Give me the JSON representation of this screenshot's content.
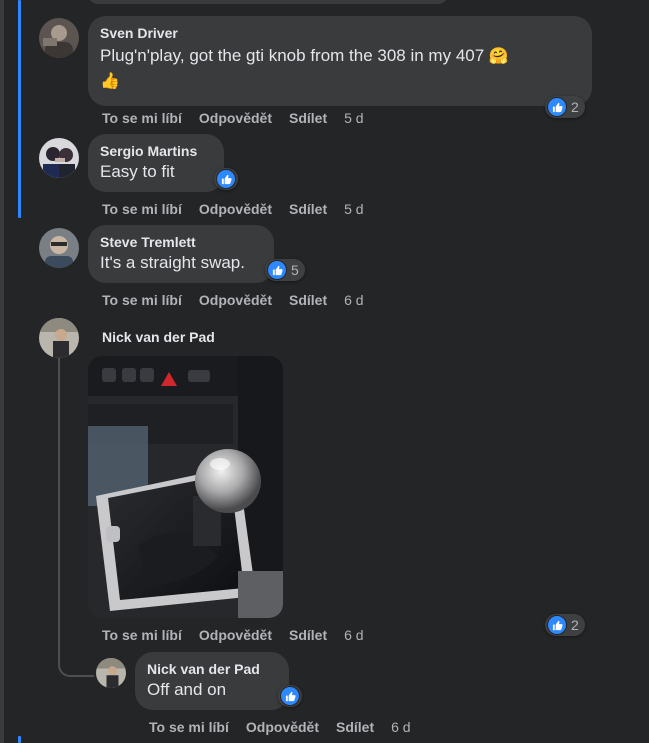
{
  "actions": {
    "like": "To se mi líbí",
    "reply": "Odpovědět",
    "share": "Sdílet"
  },
  "comments": [
    {
      "author": "Sven Driver",
      "text_line1": "Plug'n'play, got the gti knob from the 308 in my 407",
      "emoji1": "🤗",
      "emoji2": "👍",
      "time": "5 d",
      "reactions": {
        "icon": "like-icon",
        "count": "2"
      }
    },
    {
      "author": "Sergio Martins",
      "text": "Easy to fit",
      "time": "5 d",
      "reactions": {
        "icon": "like-icon",
        "count": ""
      }
    },
    {
      "author": "Steve Tremlett",
      "text": "It's a straight swap.",
      "time": "6 d",
      "reactions": {
        "icon": "like-icon",
        "count": "5"
      }
    },
    {
      "author": "Nick van der Pad",
      "text": "",
      "attachment": "gear-knob-photo",
      "time": "6 d",
      "reactions": {
        "icon": "like-icon",
        "count": "2"
      }
    },
    {
      "author": "Nick van der Pad",
      "text": "Off and on",
      "time": "6 d",
      "reactions": {
        "icon": "like-icon",
        "count": ""
      }
    }
  ],
  "colors": {
    "background": "#242526",
    "bubble": "#3a3b3c",
    "accent": "#2d88ff",
    "like": "#2e89ff"
  }
}
